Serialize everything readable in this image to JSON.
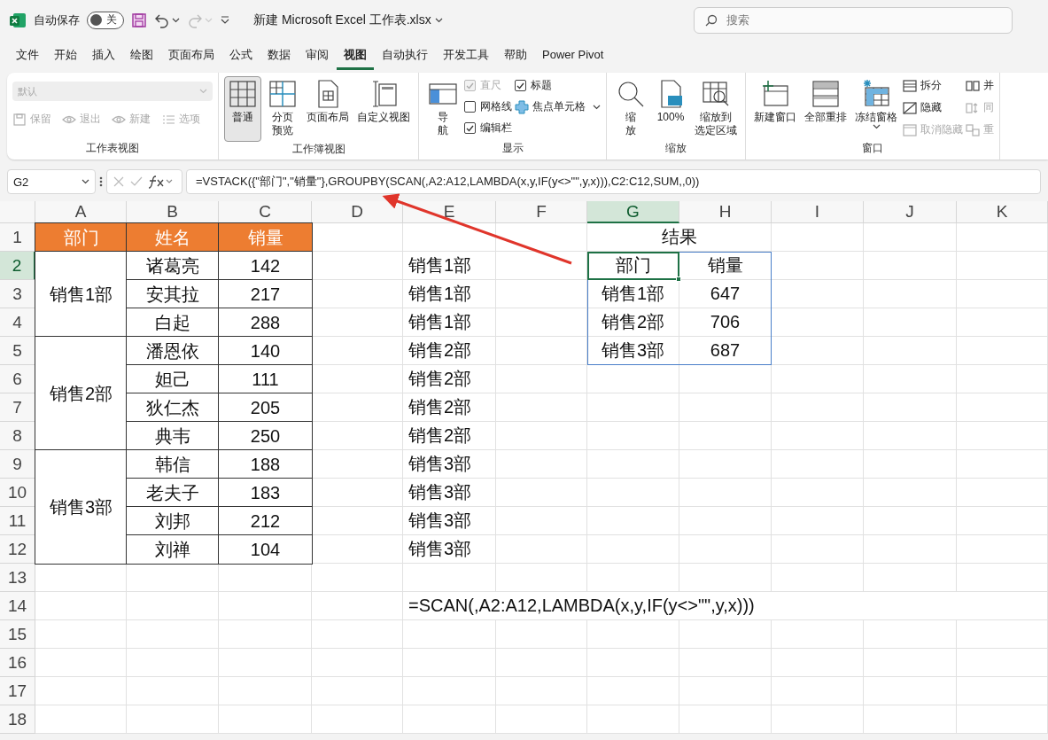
{
  "title_bar": {
    "autosave_label": "自动保存",
    "autosave": {
      "on": false,
      "text": "关"
    },
    "redo_disabled": true,
    "filename": "新建 Microsoft Excel 工作表.xlsx",
    "search": {
      "placeholder": "搜索"
    }
  },
  "menu_tabs": [
    {
      "label": "文件",
      "selected": false
    },
    {
      "label": "开始",
      "selected": false
    },
    {
      "label": "插入",
      "selected": false
    },
    {
      "label": "绘图",
      "selected": false
    },
    {
      "label": "页面布局",
      "selected": false
    },
    {
      "label": "公式",
      "selected": false
    },
    {
      "label": "数据",
      "selected": false
    },
    {
      "label": "审阅",
      "selected": false
    },
    {
      "label": "视图",
      "selected": true
    },
    {
      "label": "自动执行",
      "selected": false
    },
    {
      "label": "开发工具",
      "selected": false
    },
    {
      "label": "帮助",
      "selected": false
    },
    {
      "label": "Power Pivot",
      "selected": false
    }
  ],
  "ribbon": [
    {
      "label": "工作表视图",
      "items": [
        {
          "kind": "select",
          "value": "默认",
          "disabled": true
        },
        {
          "kind": "small_row",
          "buttons": [
            {
              "label": "保留",
              "disabled": true
            },
            {
              "label": "退出",
              "disabled": true
            },
            {
              "label": "新建",
              "disabled": true
            },
            {
              "label": "选项",
              "disabled": true
            }
          ]
        }
      ]
    },
    {
      "label": "工作簿视图",
      "items": [
        {
          "kind": "large",
          "lines": [
            "普通"
          ],
          "selected": true
        },
        {
          "kind": "large",
          "lines": [
            "分页",
            "预览"
          ],
          "selected": false
        },
        {
          "kind": "large",
          "lines": [
            "页面布局"
          ],
          "selected": false
        },
        {
          "kind": "large",
          "lines": [
            "自定义视图"
          ],
          "selected": false
        }
      ]
    },
    {
      "label": "显示",
      "items": [
        {
          "kind": "large",
          "lines": [
            "导",
            "航"
          ],
          "selected": false
        },
        {
          "kind": "checks",
          "checks": [
            {
              "label": "直尺",
              "checked": true,
              "disabled": true
            },
            {
              "label": "网格线",
              "checked": false,
              "disabled": false
            },
            {
              "label": "编辑栏",
              "checked": true,
              "disabled": false
            }
          ]
        },
        {
          "kind": "checks",
          "checks": [
            {
              "label": "标题",
              "checked": true,
              "disabled": false
            }
          ],
          "focus": {
            "label": "焦点单元格"
          }
        }
      ]
    },
    {
      "label": "缩放",
      "items": [
        {
          "kind": "large",
          "lines": [
            "缩",
            "放"
          ],
          "selected": false
        },
        {
          "kind": "large",
          "lines": [
            "100%"
          ],
          "selected": false
        },
        {
          "kind": "large",
          "lines": [
            "缩放到",
            "选定区域"
          ],
          "selected": false
        }
      ]
    },
    {
      "label": "窗口",
      "items": [
        {
          "kind": "large",
          "lines": [
            "新建窗口"
          ],
          "selected": false
        },
        {
          "kind": "large",
          "lines": [
            "全部重排"
          ],
          "selected": false
        },
        {
          "kind": "large",
          "lines": [
            "冻结窗格"
          ],
          "selected": false,
          "dropdown": true
        },
        {
          "kind": "small_col",
          "buttons": [
            {
              "label": "拆分",
              "disabled": false
            },
            {
              "label": "隐藏",
              "disabled": false
            },
            {
              "label": "取消隐藏",
              "disabled": true
            }
          ]
        },
        {
          "kind": "small_col",
          "buttons": [
            {
              "label": "并",
              "disabled": false
            },
            {
              "label": "同",
              "disabled": true
            },
            {
              "label": "重",
              "disabled": true
            }
          ]
        }
      ]
    }
  ],
  "formula_bar": {
    "name_box": "G2",
    "formula": "=VSTACK({\"部门\",\"销量\"},GROUPBY(SCAN(,A2:A12,LAMBDA(x,y,IF(y<>\"\",y,x))),C2:C12,SUM,,0))"
  },
  "sheet": {
    "columns": [
      {
        "label": "A",
        "selected": false
      },
      {
        "label": "B",
        "selected": false
      },
      {
        "label": "C",
        "selected": false
      },
      {
        "label": "D",
        "selected": false
      },
      {
        "label": "E",
        "selected": false
      },
      {
        "label": "F",
        "selected": false
      },
      {
        "label": "G",
        "selected": true
      },
      {
        "label": "H",
        "selected": false
      },
      {
        "label": "I",
        "selected": false
      },
      {
        "label": "J",
        "selected": false
      },
      {
        "label": "K",
        "selected": false
      }
    ],
    "rows": [
      {
        "label": "1",
        "selected": false
      },
      {
        "label": "2",
        "selected": true
      },
      {
        "label": "3",
        "selected": false
      },
      {
        "label": "4",
        "selected": false
      },
      {
        "label": "5",
        "selected": false
      },
      {
        "label": "6",
        "selected": false
      },
      {
        "label": "7",
        "selected": false
      },
      {
        "label": "8",
        "selected": false
      },
      {
        "label": "9",
        "selected": false
      },
      {
        "label": "10",
        "selected": false
      },
      {
        "label": "11",
        "selected": false
      },
      {
        "label": "12",
        "selected": false
      },
      {
        "label": "13",
        "selected": false
      },
      {
        "label": "14",
        "selected": false
      },
      {
        "label": "15",
        "selected": false
      },
      {
        "label": "16",
        "selected": false
      },
      {
        "label": "17",
        "selected": false
      },
      {
        "label": "18",
        "selected": false
      }
    ],
    "source_table": {
      "headers": [
        "部门",
        "姓名",
        "销量"
      ],
      "groups": [
        {
          "department": "销售1部",
          "rows": [
            {
              "name": "诸葛亮",
              "sales": "142"
            },
            {
              "name": "安其拉",
              "sales": "217"
            },
            {
              "name": "白起",
              "sales": "288"
            }
          ]
        },
        {
          "department": "销售2部",
          "rows": [
            {
              "name": "潘恩依",
              "sales": "140"
            },
            {
              "name": "妲己",
              "sales": "111"
            },
            {
              "name": "狄仁杰",
              "sales": "205"
            },
            {
              "name": "典韦",
              "sales": "250"
            }
          ]
        },
        {
          "department": "销售3部",
          "rows": [
            {
              "name": "韩信",
              "sales": "188"
            },
            {
              "name": "老夫子",
              "sales": "183"
            },
            {
              "name": "刘邦",
              "sales": "212"
            },
            {
              "name": "刘禅",
              "sales": "104"
            }
          ]
        }
      ]
    },
    "helper_column": [
      "销售1部",
      "销售1部",
      "销售1部",
      "销售2部",
      "销售2部",
      "销售2部",
      "销售2部",
      "销售3部",
      "销售3部",
      "销售3部",
      "销售3部"
    ],
    "helper_formula": "=SCAN(,A2:A12,LAMBDA(x,y,IF(y<>\"\",y,x)))",
    "result": {
      "title": "结果",
      "headers": [
        "部门",
        "销量"
      ],
      "rows": [
        {
          "department": "销售1部",
          "sales": "647"
        },
        {
          "department": "销售2部",
          "sales": "706"
        },
        {
          "department": "销售3部",
          "sales": "687"
        }
      ]
    }
  }
}
